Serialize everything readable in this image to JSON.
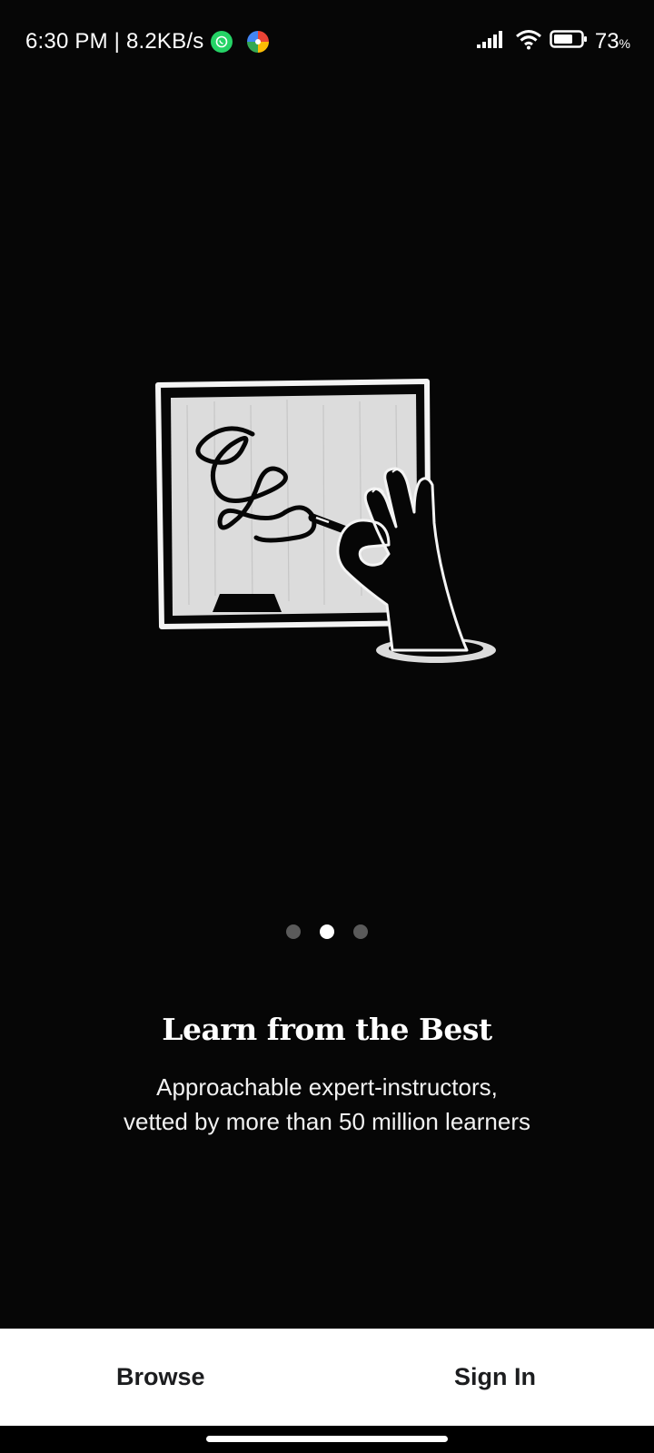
{
  "status_bar": {
    "time": "6:30 PM | 8.2KB/s",
    "battery_percent": "73",
    "battery_unit": "%",
    "battery_level": 0.73,
    "icons": [
      "whatsapp-icon",
      "photos-icon",
      "signal-icon",
      "wifi-icon",
      "battery-icon"
    ]
  },
  "illustration": {
    "icon": "hand-drawing-on-screen-icon",
    "colors": {
      "screen_fill": "#dcdcdc",
      "outline": "#ffffff",
      "ink": "#000000"
    }
  },
  "pager": {
    "count": 3,
    "active_index": 1
  },
  "onboarding": {
    "headline": "Learn from the Best",
    "subtext_line1": "Approachable expert-instructors,",
    "subtext_line2": "vetted by more than 50 million learners"
  },
  "actions": {
    "browse_label": "Browse",
    "signin_label": "Sign In"
  },
  "colors": {
    "background": "#060606",
    "bottom_bar": "#ffffff",
    "button_text": "#1c1d1f",
    "dot_inactive": "#5a5a5a",
    "dot_active": "#ffffff"
  }
}
